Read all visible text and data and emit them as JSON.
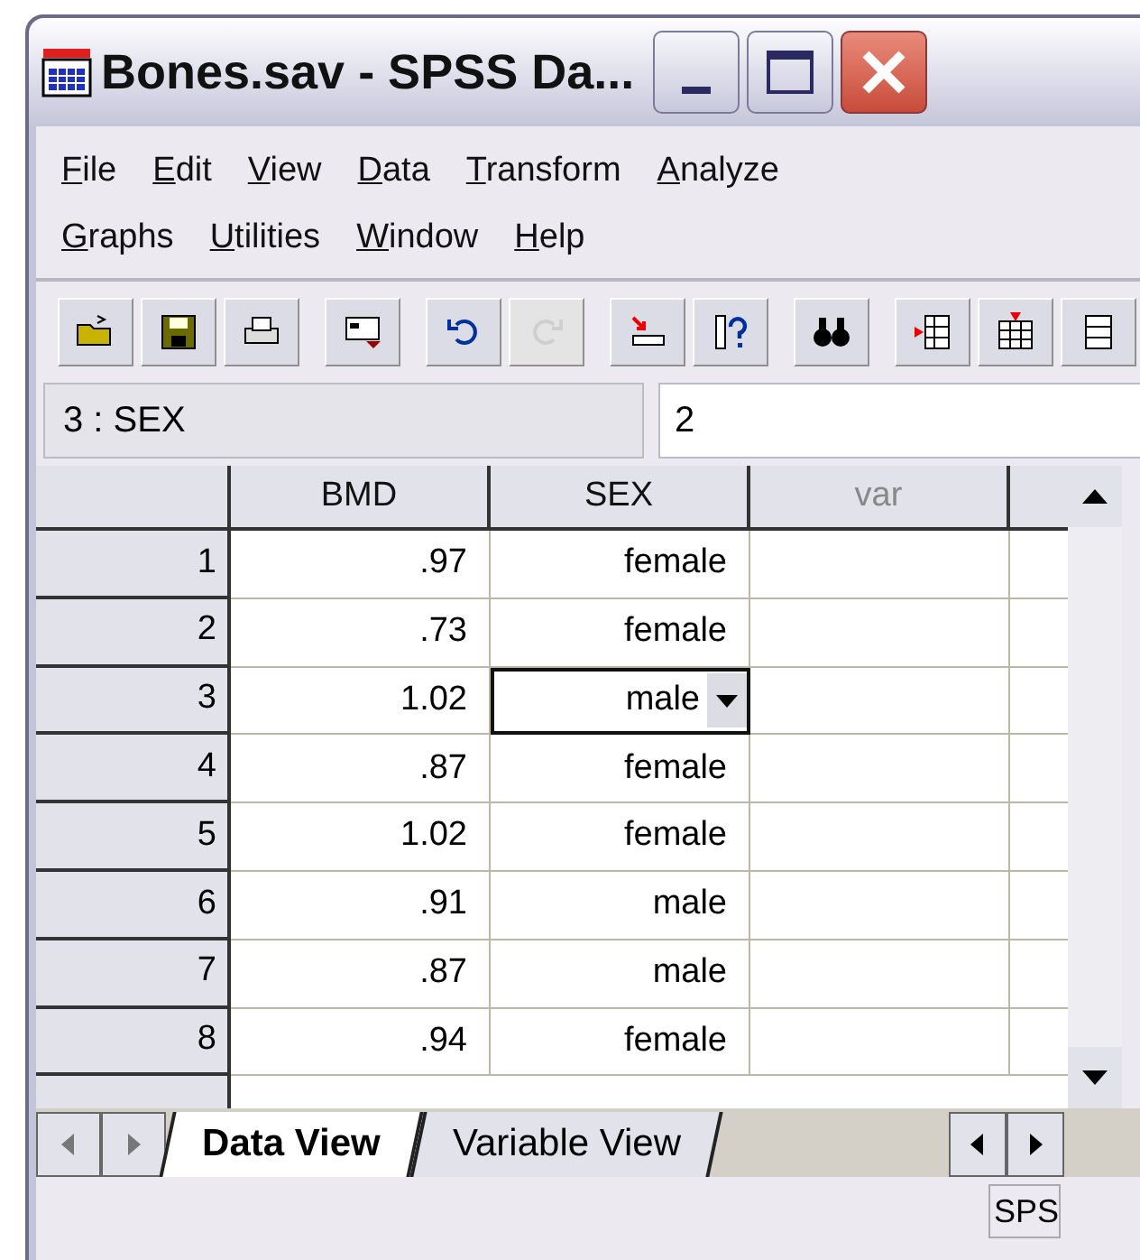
{
  "window": {
    "title": "Bones.sav - SPSS Da..."
  },
  "menu_bar": {
    "items": [
      "File",
      "Edit",
      "View",
      "Data",
      "Transform",
      "Analyze",
      "Graphs",
      "Utilities",
      "Window",
      "Help"
    ]
  },
  "toolbar": [
    {
      "kind": "open",
      "disabled": false
    },
    {
      "kind": "save",
      "disabled": false
    },
    {
      "kind": "print",
      "disabled": false
    },
    {
      "kind": "recall",
      "disabled": false
    },
    {
      "kind": "undo",
      "disabled": false
    },
    {
      "kind": "redo",
      "disabled": true
    },
    {
      "kind": "goto",
      "disabled": false
    },
    {
      "kind": "variables",
      "disabled": false
    },
    {
      "kind": "find",
      "disabled": false
    },
    {
      "kind": "insert-case",
      "disabled": false
    },
    {
      "kind": "insert-variable",
      "disabled": false
    },
    {
      "kind": "split",
      "disabled": false
    }
  ],
  "cell_editor": {
    "reference": "3 : SEX",
    "value": "2"
  },
  "grid": {
    "columns": [
      {
        "label": "BMD",
        "kind": "variable"
      },
      {
        "label": "SEX",
        "kind": "variable"
      },
      {
        "label": "var",
        "kind": "empty"
      }
    ],
    "rows": [
      {
        "case": "1",
        "cells": [
          {
            "value": ".97",
            "selected": false
          },
          {
            "value": "female",
            "selected": false
          }
        ]
      },
      {
        "case": "2",
        "cells": [
          {
            "value": ".73",
            "selected": false
          },
          {
            "value": "female",
            "selected": false
          }
        ]
      },
      {
        "case": "3",
        "cells": [
          {
            "value": "1.02",
            "selected": false
          },
          {
            "value": "male",
            "selected": true
          }
        ]
      },
      {
        "case": "4",
        "cells": [
          {
            "value": ".87",
            "selected": false
          },
          {
            "value": "female",
            "selected": false
          }
        ]
      },
      {
        "case": "5",
        "cells": [
          {
            "value": "1.02",
            "selected": false
          },
          {
            "value": "female",
            "selected": false
          }
        ]
      },
      {
        "case": "6",
        "cells": [
          {
            "value": ".91",
            "selected": false
          },
          {
            "value": "male",
            "selected": false
          }
        ]
      },
      {
        "case": "7",
        "cells": [
          {
            "value": ".87",
            "selected": false
          },
          {
            "value": "male",
            "selected": false
          }
        ]
      },
      {
        "case": "8",
        "cells": [
          {
            "value": ".94",
            "selected": false
          },
          {
            "value": "female",
            "selected": false
          }
        ]
      }
    ]
  },
  "tabs": [
    {
      "label": "Data View",
      "selected": true
    },
    {
      "label": "Variable View",
      "selected": false
    }
  ],
  "status_bar": {
    "panel": "SPS"
  }
}
